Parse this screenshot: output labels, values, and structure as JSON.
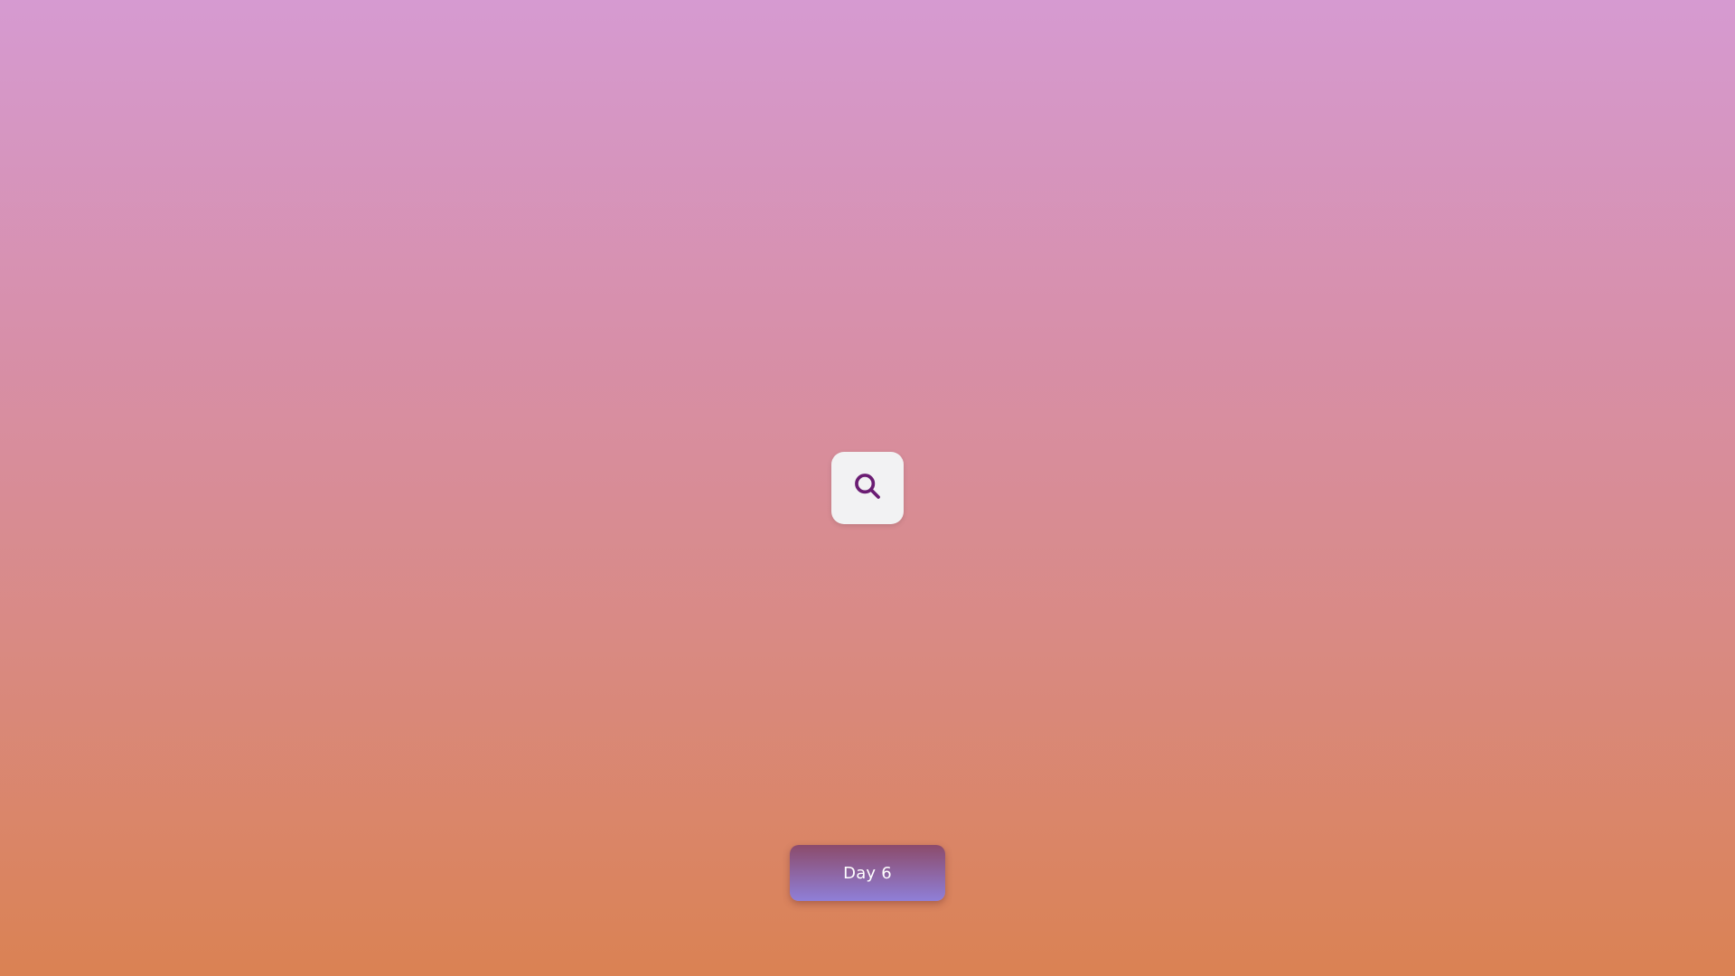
{
  "search": {
    "icon": "search-icon",
    "icon_color": "#6b1d73",
    "button_bg": "#f2f2f3"
  },
  "day": {
    "label": "Day 6"
  },
  "colors": {
    "background_top": "#d69ad1",
    "background_bottom": "#da8253",
    "badge_top": "#8c4b6b",
    "badge_bottom": "#8f7fd8"
  }
}
